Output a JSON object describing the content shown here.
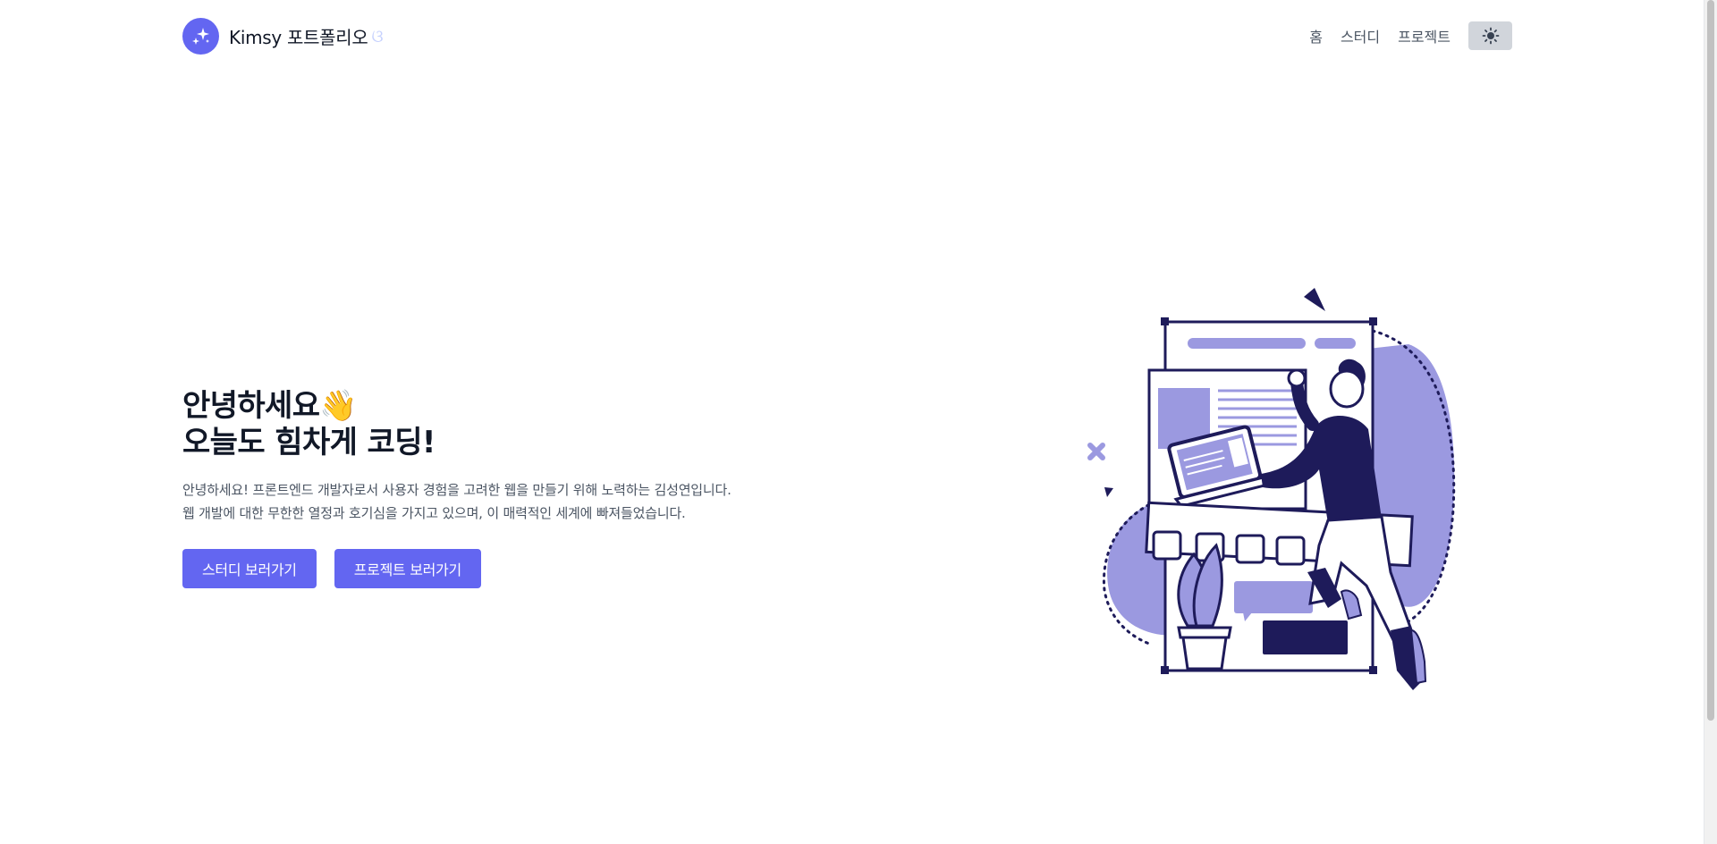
{
  "header": {
    "brand_name": "Kimsy 포트폴리오",
    "brand_deco": "ଓ",
    "logo_icon": "sparkles-icon",
    "nav": [
      {
        "label": "홈"
      },
      {
        "label": "스터디"
      },
      {
        "label": "프로젝트"
      }
    ],
    "theme_toggle_icon": "sun-icon"
  },
  "hero": {
    "title_line1": "안녕하세요👋",
    "title_line2": "오늘도 힘차게 코딩!",
    "desc_line1": "안녕하세요! 프론트엔드 개발자로서 사용자 경험을 고려한 웹을 만들기 위해 노력하는 김성연입니다.",
    "desc_line2": "웹 개발에 대한 무한한 열정과 호기심을 가지고 있으며, 이 매력적인 세계에 빠져들었습니다.",
    "study_button": "스터디 보러가기",
    "project_button": "프로젝트 보러가기",
    "illustration": "developer-building-webpage-illustration"
  },
  "colors": {
    "accent": "#6366f1",
    "illustration_light": "#9b99e0",
    "illustration_dark": "#1e1b5a",
    "text_primary": "#111827",
    "text_secondary": "#4b5563",
    "theme_button_bg": "#d1d5db"
  }
}
